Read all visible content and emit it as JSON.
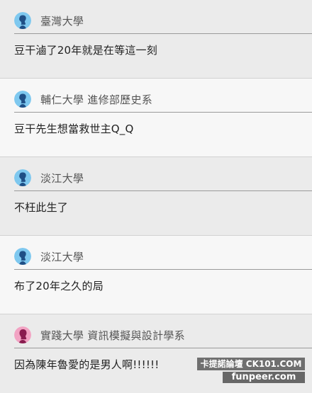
{
  "comments": [
    {
      "school": "臺灣大學",
      "text": "豆干滷了20年就是在等這一刻",
      "avatar": "male-silhouette-icon"
    },
    {
      "school": "輔仁大學 進修部歷史系",
      "text": "豆干先生想當救世主Q_Q",
      "avatar": "male-silhouette-icon"
    },
    {
      "school": "淡江大學",
      "text": "不枉此生了",
      "avatar": "male-silhouette-icon"
    },
    {
      "school": "淡江大學",
      "text": "布了20年之久的局",
      "avatar": "male-silhouette-icon"
    },
    {
      "school": "實踐大學 資訊模擬與設計學系",
      "text": "因為陳年魯愛的是男人啊!!!!!!",
      "avatar": "female-silhouette-icon"
    }
  ],
  "colors": {
    "male_avatar_bg": "#7ec8ef",
    "male_avatar_fg": "#1f4f86",
    "female_avatar_bg": "#f2a3c3",
    "female_avatar_fg": "#8a1c4f"
  },
  "watermark": {
    "line1": "卡提諾論壇 CK101.COM",
    "line2": "funpeer.com"
  }
}
